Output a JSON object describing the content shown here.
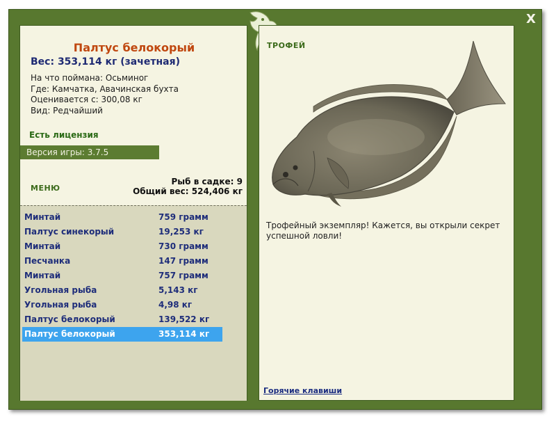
{
  "window": {
    "close_label": "X"
  },
  "fish": {
    "name": "Палтус белокорый",
    "weight_line": "Вес: 353,114 кг (зачетная)",
    "caught_on": "На что поймана: Осьминог",
    "location": "Где: Камчатка, Авачинская бухта",
    "value": "Оценивается с: 300,08 кг",
    "kind": "Вид: Редчайший"
  },
  "license": "Есть лицензия",
  "version": "Версия игры: 3.7.5",
  "menu_label": "МЕНЮ",
  "cage": {
    "count": "Рыб в садке: 9",
    "total": "Общий вес: 524,406 кг"
  },
  "catches": [
    {
      "name": "Минтай",
      "weight": "759 грамм"
    },
    {
      "name": "Палтус синекорый",
      "weight": "19,253 кг"
    },
    {
      "name": "Минтай",
      "weight": "730 грамм"
    },
    {
      "name": "Песчанка",
      "weight": "147 грамм"
    },
    {
      "name": "Минтай",
      "weight": "757 грамм"
    },
    {
      "name": "Угольная рыба",
      "weight": "5,143 кг"
    },
    {
      "name": "Угольная рыба",
      "weight": "4,98 кг"
    },
    {
      "name": "Палтус белокорый",
      "weight": "139,522 кг"
    },
    {
      "name": "Палтус белокорый",
      "weight": "353,114 кг"
    }
  ],
  "selected_index": 8,
  "trophy_label": "ТРОФЕЙ",
  "description": "Трофейный экземпляр! Кажется, вы открыли секрет успешной ловли!",
  "hotkeys": "Горячие клавиши",
  "colors": {
    "frame": "#58782f",
    "panel": "#f5f4e2",
    "list_bg": "#d9d8be",
    "selected": "#3da4ee",
    "fish_name": "#c0470f",
    "link": "#1a2c80"
  }
}
